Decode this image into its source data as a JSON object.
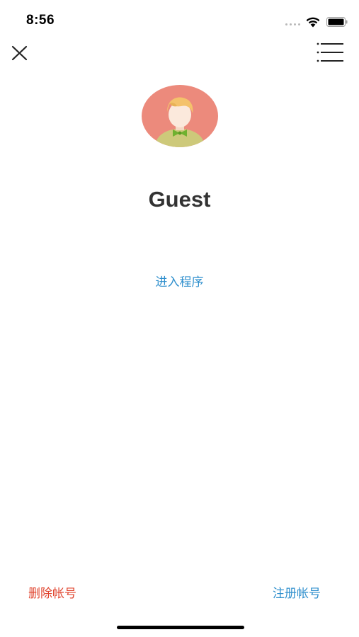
{
  "status_bar": {
    "time": "8:56",
    "wifi_icon": "wifi-icon",
    "battery_icon": "battery-icon"
  },
  "nav": {
    "close_icon": "close-icon",
    "menu_icon": "menu-icon"
  },
  "profile": {
    "avatar_icon": "avatar-icon",
    "username": "Guest",
    "enter_program_label": "进入程序"
  },
  "footer": {
    "delete_account_label": "删除帐号",
    "register_account_label": "注册帐号"
  },
  "colors": {
    "link_blue": "#2f8fcd",
    "danger_red": "#e0442e",
    "avatar_bg": "#ec8a7c"
  }
}
